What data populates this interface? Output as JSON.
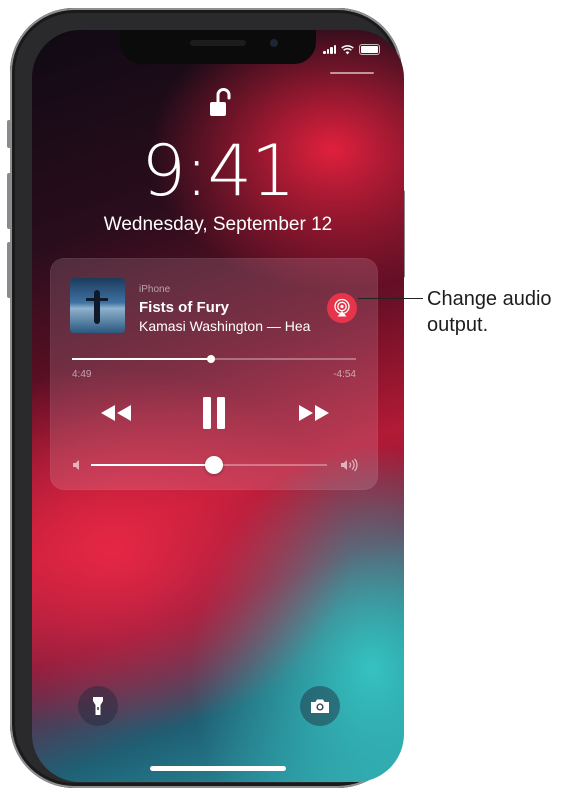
{
  "lock_screen": {
    "time": "9:41",
    "date": "Wednesday, September 12"
  },
  "now_playing": {
    "source": "iPhone",
    "song_title": "Fists of Fury",
    "artist_line": "Kamasi Washington — Hea",
    "elapsed": "4:49",
    "remaining": "-4:54",
    "progress_fraction": 0.49,
    "volume_fraction": 0.52
  },
  "icons": {
    "lock": "unlocked-padlock-icon",
    "airplay": "airplay-audio-icon",
    "rewind": "rewind-icon",
    "pause": "pause-icon",
    "forward": "fast-forward-icon",
    "volume_low": "volume-low-icon",
    "volume_high": "volume-high-icon",
    "flashlight": "flashlight-icon",
    "camera": "camera-icon"
  },
  "callout": {
    "text": "Change audio output."
  },
  "colors": {
    "airplay_accent": "#e6344a"
  }
}
